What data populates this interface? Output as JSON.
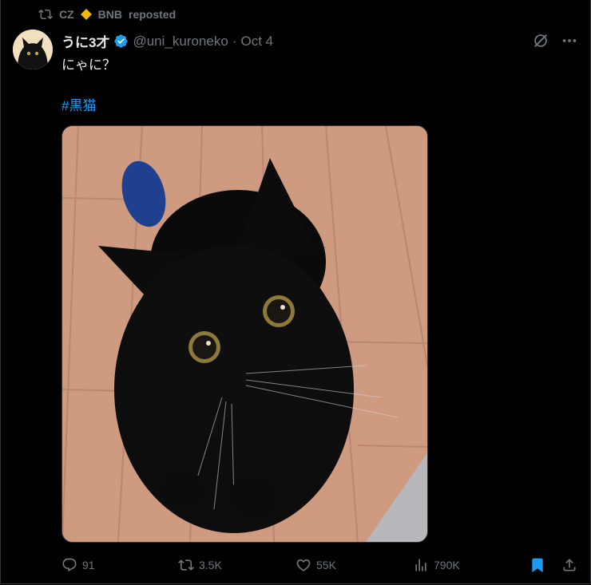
{
  "repost": {
    "user": "CZ",
    "org": "BNB",
    "label": "reposted"
  },
  "tweet": {
    "display_name": "うに3才",
    "handle": "@uni_kuroneko",
    "separator": "·",
    "time": "Oct 4",
    "text": "にゃに？",
    "hashtag": "#黒猫"
  },
  "metrics": {
    "replies": "91",
    "reposts": "3.5K",
    "likes": "55K",
    "views": "790K"
  },
  "icons": {
    "repost": "repost-icon",
    "verified": "verified-badge-icon",
    "grok": "grok-icon",
    "more": "more-icon",
    "reply": "reply-icon",
    "like": "like-icon",
    "views": "views-icon",
    "bookmark": "bookmark-icon",
    "share": "share-icon"
  },
  "colors": {
    "background": "#000000",
    "text": "#e7e9ea",
    "muted": "#71767b",
    "accent": "#1d9bf0",
    "bnb": "#f0b90b"
  }
}
